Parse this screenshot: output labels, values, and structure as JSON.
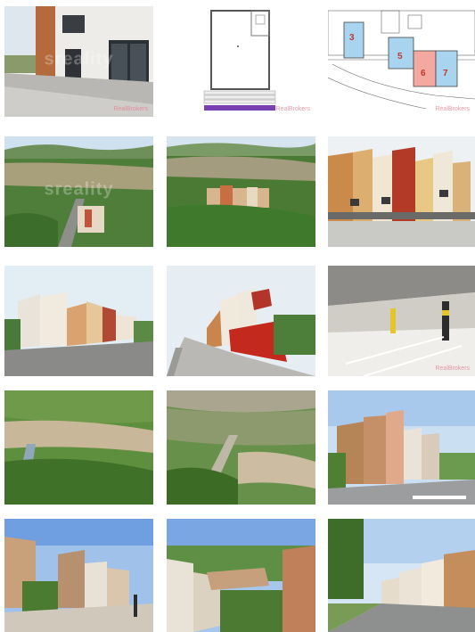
{
  "gallery": {
    "watermark_text": "sreality",
    "watermark_brand": "RealBrokers",
    "photos": [
      {
        "name": "entrance-photo"
      },
      {
        "name": "floorplan-photo"
      },
      {
        "name": "site-plan-photo"
      },
      {
        "name": "valley-view-photo"
      },
      {
        "name": "forest-view-photo"
      },
      {
        "name": "facade-front-photo"
      },
      {
        "name": "building-side-photo"
      },
      {
        "name": "red-wall-photo"
      },
      {
        "name": "garage-photo"
      },
      {
        "name": "aerial-valley-photo"
      },
      {
        "name": "aerial-town-photo"
      },
      {
        "name": "street-render-photo"
      },
      {
        "name": "plaza-render-photo"
      },
      {
        "name": "terraces-render-photo"
      },
      {
        "name": "road-render-photo"
      }
    ]
  },
  "site_plan": {
    "units": [
      "3",
      "5",
      "6",
      "7"
    ]
  },
  "floorplan": {
    "legend_rows": [
      "—",
      "—",
      "—"
    ]
  },
  "colors": {
    "brand_pink": "#e87a8f",
    "unit_blue": "#a8d4f0",
    "unit_pink": "#f4a9a0",
    "purple_bar": "#7a3fb0"
  }
}
